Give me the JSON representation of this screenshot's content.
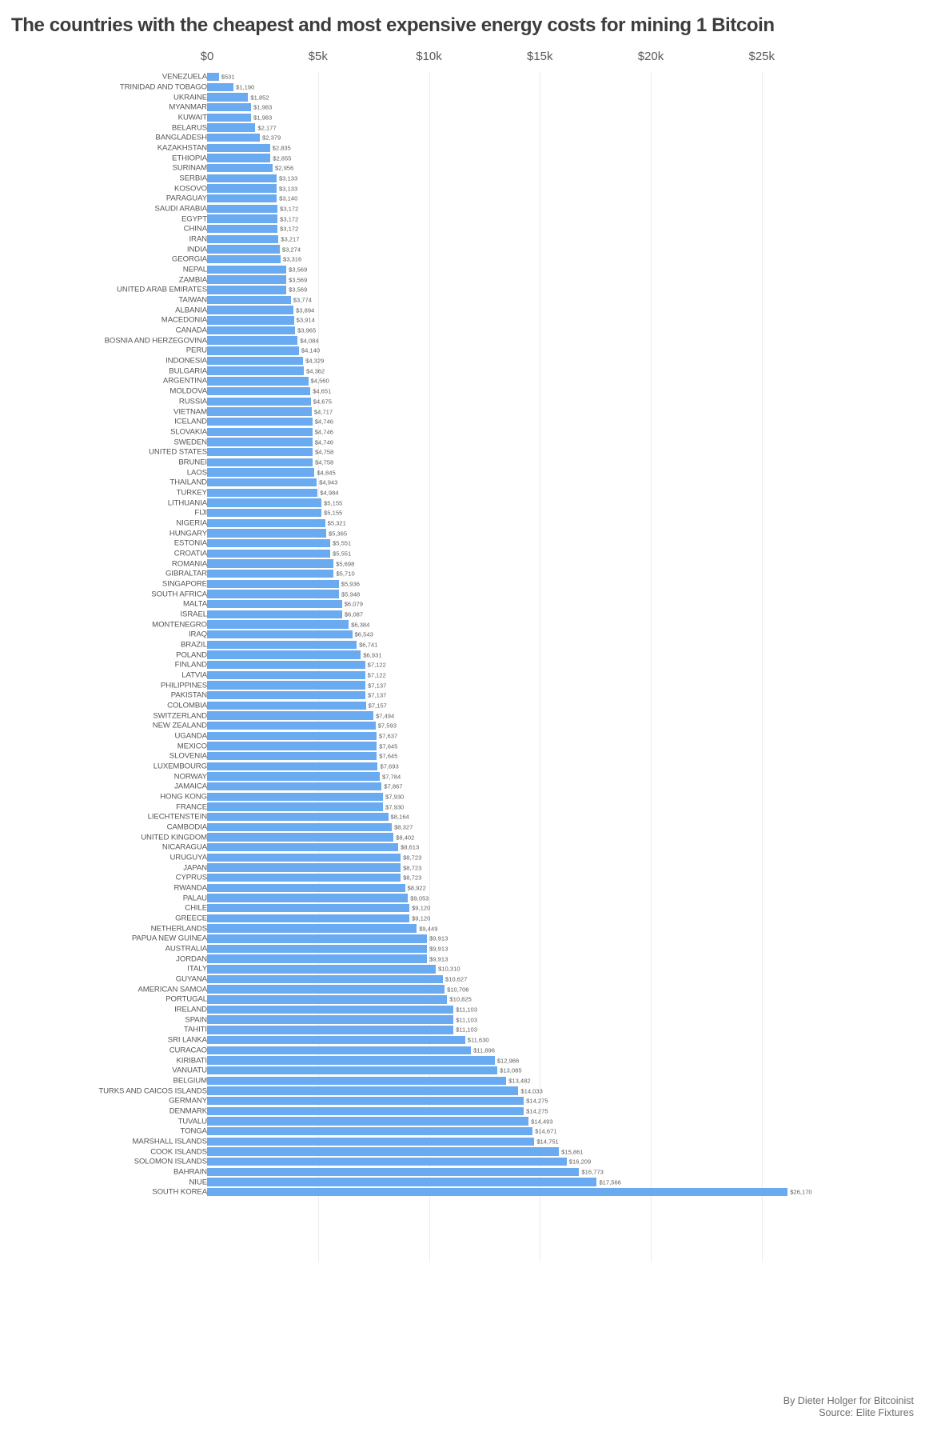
{
  "chart_data": {
    "type": "bar",
    "orientation": "horizontal",
    "title": "The countries with the cheapest and most expensive energy costs for mining 1 Bitcoin",
    "xlabel": "",
    "ylabel": "",
    "xlim": [
      0,
      27500
    ],
    "grid": true,
    "legend": false,
    "tick_labels": [
      "$0",
      "$5k",
      "$10k",
      "$15k",
      "$20k",
      "$25k"
    ],
    "tick_values": [
      0,
      5000,
      10000,
      15000,
      20000,
      25000
    ],
    "value_prefix": "$",
    "bar_color": "#6aaaf0",
    "categories": [
      "VENEZUELA",
      "TRINIDAD AND TOBAGO",
      "UKRAINE",
      "MYANMAR",
      "KUWAIT",
      "BELARUS",
      "BANGLADESH",
      "KAZAKHSTAN",
      "ETHIOPIA",
      "SURINAM",
      "SERBIA",
      "KOSOVO",
      "PARAGUAY",
      "SAUDI ARABIA",
      "EGYPT",
      "CHINA",
      "IRAN",
      "INDIA",
      "GEORGIA",
      "NEPAL",
      "ZAMBIA",
      "UNITED ARAB EMIRATES",
      "TAIWAN",
      "ALBANIA",
      "MACEDONIA",
      "CANADA",
      "BOSNIA AND HERZEGOVINA",
      "PERU",
      "INDONESIA",
      "BULGARIA",
      "ARGENTINA",
      "MOLDOVA",
      "RUSSIA",
      "VIETNAM",
      "ICELAND",
      "SLOVAKIA",
      "SWEDEN",
      "UNITED STATES",
      "BRUNEI",
      "LAOS",
      "THAILAND",
      "TURKEY",
      "LITHUANIA",
      "FIJI",
      "NIGERIA",
      "HUNGARY",
      "ESTONIA",
      "CROATIA",
      "ROMANIA",
      "GIBRALTAR",
      "SINGAPORE",
      "SOUTH AFRICA",
      "MALTA",
      "ISRAEL",
      "MONTENEGRO",
      "IRAQ",
      "BRAZIL",
      "POLAND",
      "FINLAND",
      "LATVIA",
      "PHILIPPINES",
      "PAKISTAN",
      "COLOMBIA",
      "SWITZERLAND",
      "NEW ZEALAND",
      "UGANDA",
      "MEXICO",
      "SLOVENIA",
      "LUXEMBOURG",
      "NORWAY",
      "JAMAICA",
      "HONG KONG",
      "FRANCE",
      "LIECHTENSTEIN",
      "CAMBODIA",
      "UNITED KINGDOM",
      "NICARAGUA",
      "URUGUYA",
      "JAPAN",
      "CYPRUS",
      "RWANDA",
      "PALAU",
      "CHILE",
      "GREECE",
      "NETHERLANDS",
      "PAPUA NEW GUINEA",
      "AUSTRALIA",
      "JORDAN",
      "ITALY",
      "GUYANA",
      "AMERICAN SAMOA",
      "PORTUGAL",
      "IRELAND",
      "SPAIN",
      "TAHITI",
      "SRI LANKA",
      "CURACAO",
      "KIRIBATI",
      "VANUATU",
      "BELGIUM",
      "TURKS AND CAICOS ISLANDS",
      "GERMANY",
      "DENMARK",
      "TUVALU",
      "TONGA",
      "MARSHALL ISLANDS",
      "COOK ISLANDS",
      "SOLOMON ISLANDS",
      "BAHRAIN",
      "NIUE",
      "SOUTH KOREA"
    ],
    "values": [
      531,
      1190,
      1852,
      1983,
      1983,
      2177,
      2379,
      2835,
      2855,
      2956,
      3133,
      3133,
      3140,
      3172,
      3172,
      3172,
      3217,
      3274,
      3316,
      3569,
      3569,
      3569,
      3774,
      3894,
      3914,
      3965,
      4084,
      4140,
      4329,
      4362,
      4560,
      4651,
      4675,
      4717,
      4746,
      4746,
      4746,
      4758,
      4758,
      4845,
      4943,
      4984,
      5155,
      5155,
      5321,
      5365,
      5551,
      5551,
      5698,
      5710,
      5936,
      5948,
      6079,
      6087,
      6384,
      6543,
      6741,
      6931,
      7122,
      7122,
      7137,
      7137,
      7157,
      7494,
      7593,
      7637,
      7645,
      7645,
      7693,
      7784,
      7867,
      7930,
      7930,
      8164,
      8327,
      8402,
      8613,
      8723,
      8723,
      8723,
      8922,
      9053,
      9120,
      9120,
      9449,
      9913,
      9913,
      9913,
      10310,
      10627,
      10706,
      10825,
      11103,
      11103,
      11103,
      11630,
      11896,
      12966,
      13085,
      13482,
      14033,
      14275,
      14275,
      14493,
      14671,
      14751,
      15861,
      16209,
      16773,
      17566,
      26170
    ],
    "value_labels": [
      "$531",
      "$1,190",
      "$1,852",
      "$1,983",
      "$1,983",
      "$2,177",
      "$2,379",
      "$2,835",
      "$2,855",
      "$2,956",
      "$3,133",
      "$3,133",
      "$3,140",
      "$3,172",
      "$3,172",
      "$3,172",
      "$3,217",
      "$3,274",
      "$3,316",
      "$3,569",
      "$3,569",
      "$3,569",
      "$3,774",
      "$3,894",
      "$3,914",
      "$3,965",
      "$4,084",
      "$4,140",
      "$4,329",
      "$4,362",
      "$4,560",
      "$4,651",
      "$4,675",
      "$4,717",
      "$4,746",
      "$4,746",
      "$4,746",
      "$4,758",
      "$4,758",
      "$4,845",
      "$4,943",
      "$4,984",
      "$5,155",
      "$5,155",
      "$5,321",
      "$5,365",
      "$5,551",
      "$5,551",
      "$5,698",
      "$5,710",
      "$5,936",
      "$5,948",
      "$6,079",
      "$6,087",
      "$6,384",
      "$6,543",
      "$6,741",
      "$6,931",
      "$7,122",
      "$7,122",
      "$7,137",
      "$7,137",
      "$7,157",
      "$7,494",
      "$7,593",
      "$7,637",
      "$7,645",
      "$7,645",
      "$7,693",
      "$7,784",
      "$7,867",
      "$7,930",
      "$7,930",
      "$8,164",
      "$8,327",
      "$8,402",
      "$8,613",
      "$8,723",
      "$8,723",
      "$8,723",
      "$8,922",
      "$9,053",
      "$9,120",
      "$9,120",
      "$9,449",
      "$9,913",
      "$9,913",
      "$9,913",
      "$10,310",
      "$10,627",
      "$10,706",
      "$10,825",
      "$11,103",
      "$11,103",
      "$11,103",
      "$11,630",
      "$11,896",
      "$12,966",
      "$13,085",
      "$13,482",
      "$14,033",
      "$14,275",
      "$14,275",
      "$14,493",
      "$14,671",
      "$14,751",
      "$15,861",
      "$16,209",
      "$16,773",
      "$17,566",
      "$26,170"
    ]
  },
  "footer": {
    "byline": "By Dieter Holger for Bitcoinist",
    "source": "Source: Elite Fixtures"
  }
}
